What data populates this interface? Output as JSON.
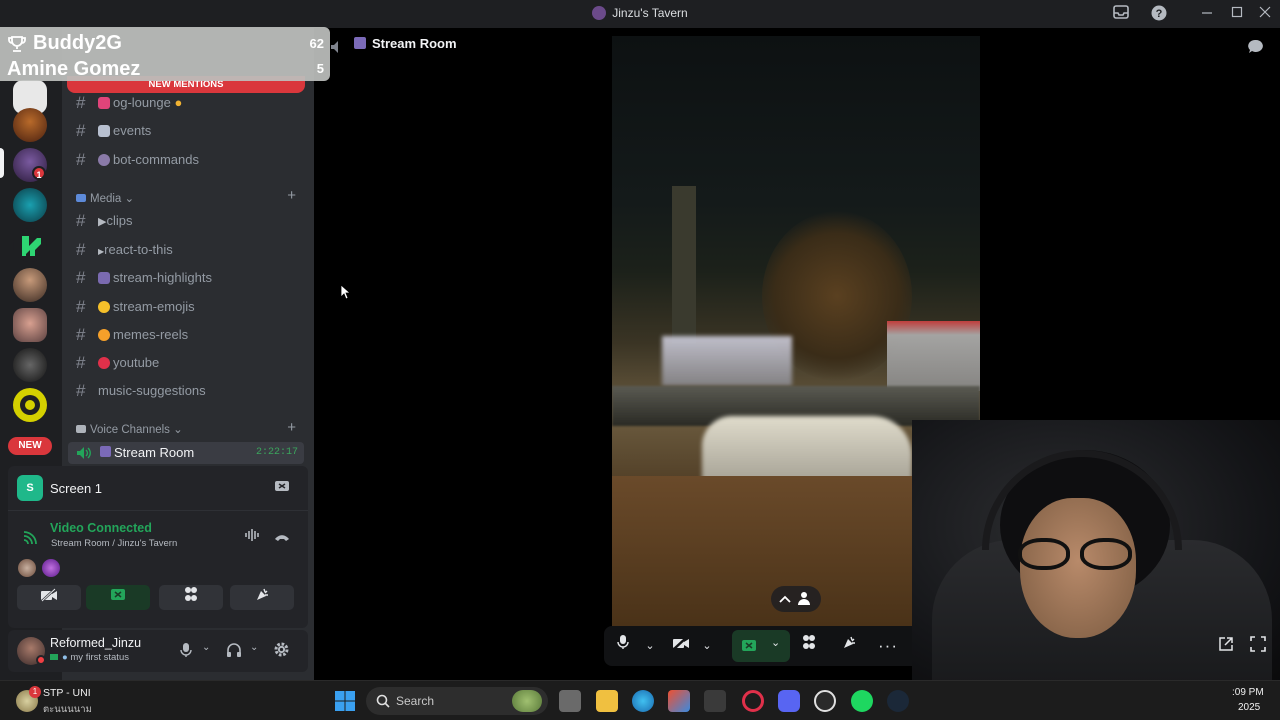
{
  "window": {
    "title": "Jinzu's Tavern"
  },
  "overlay": {
    "row1_name": "Buddy2G",
    "row1_score": "62",
    "row2_name": "Amine Gomez",
    "row2_score": "5"
  },
  "server_rail": {
    "new_badge": "NEW",
    "mention_count": "1"
  },
  "channels": {
    "new_mentions_label": "NEW MENTIONS",
    "top_items": [
      {
        "label": "og-lounge"
      },
      {
        "label": "events"
      },
      {
        "label": "bot-commands"
      }
    ],
    "media_category": "Media",
    "media_items": [
      {
        "label": "clips"
      },
      {
        "label": "react-to-this"
      },
      {
        "label": "stream-highlights"
      },
      {
        "label": "stream-emojis"
      },
      {
        "label": "memes-reels"
      },
      {
        "label": "youtube"
      },
      {
        "label": "music-suggestions"
      }
    ],
    "voice_category": "Voice Channels",
    "voice_channel": {
      "label": "Stream Room",
      "duration": "2:22:17"
    }
  },
  "rtc_panel": {
    "screen_label": "Screen 1",
    "screen_avatar_letter": "S",
    "status": "Video Connected",
    "location": "Stream Room / Jinzu's Tavern"
  },
  "user": {
    "name": "Reformed_Jinzu",
    "status": "my first status"
  },
  "stage": {
    "channel_name": "Stream Room"
  },
  "taskbar": {
    "weather_title": "STP - UNI",
    "weather_sub": "ตะนนนนาม",
    "search_placeholder": "Search",
    "clock_time": ":09 PM",
    "clock_date": "2025"
  },
  "colors": {
    "accent_green": "#23a55a",
    "mention_red": "#da373c",
    "discord_blurple": "#5865f2"
  }
}
